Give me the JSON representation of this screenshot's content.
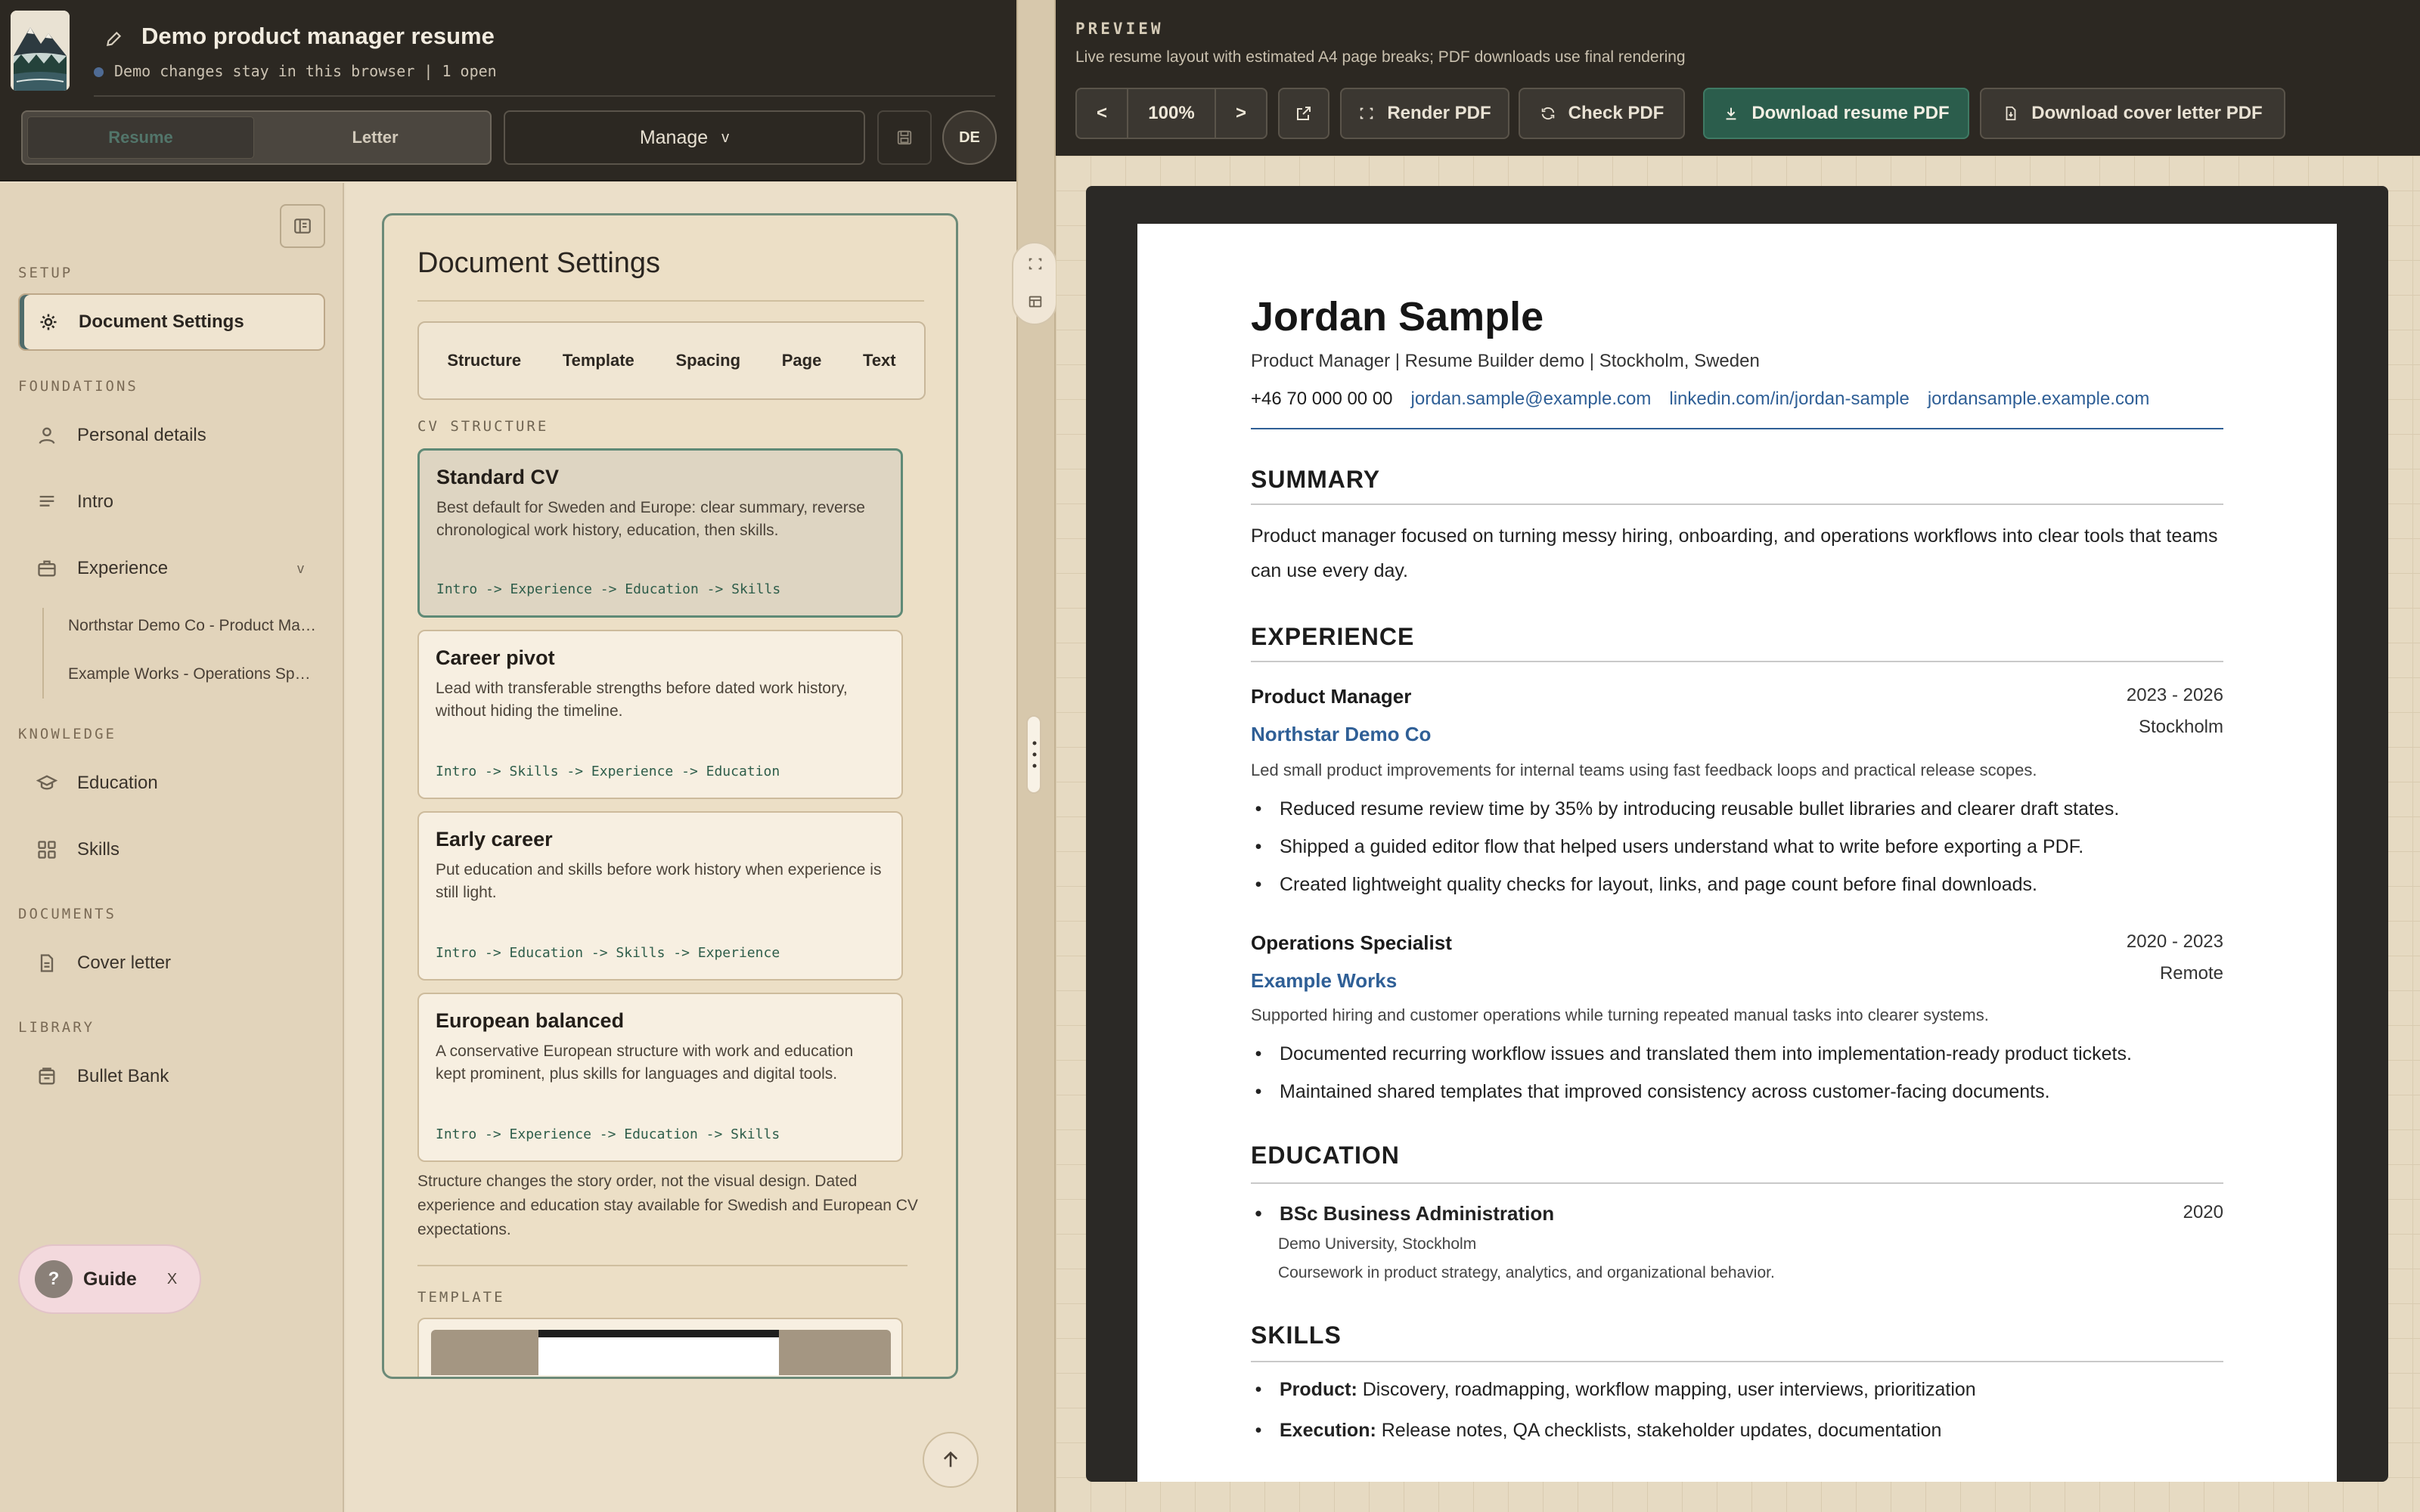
{
  "header": {
    "doc_title": "Demo product manager resume",
    "status": "Demo changes stay in this browser | 1 open",
    "mode_tabs": [
      "Resume",
      "Letter"
    ],
    "active_mode": "Resume",
    "manage_label": "Manage",
    "manage_caret": "v",
    "avatar_initials": "DE"
  },
  "sidebar": {
    "sections": {
      "setup": "SETUP",
      "foundations": "FOUNDATIONS",
      "knowledge": "KNOWLEDGE",
      "documents": "DOCUMENTS",
      "library": "LIBRARY"
    },
    "items": {
      "document_settings": "Document Settings",
      "personal_details": "Personal details",
      "intro": "Intro",
      "experience": "Experience",
      "experience_caret": "v",
      "education": "Education",
      "skills": "Skills",
      "cover_letter": "Cover letter",
      "bullet_bank": "Bullet Bank"
    },
    "experience_sub": [
      "Northstar Demo Co - Product Manager",
      "Example Works - Operations Specialist"
    ],
    "guide": {
      "q": "?",
      "label": "Guide",
      "close": "X"
    }
  },
  "settings_panel": {
    "title": "Document Settings",
    "tabs": [
      "Structure",
      "Template",
      "Spacing",
      "Page",
      "Text"
    ],
    "cv_structure_label": "CV STRUCTURE",
    "cards": [
      {
        "title": "Standard CV",
        "desc": "Best default for Sweden and Europe: clear summary, reverse chronological work history, education, then skills.",
        "flow": "Intro -> Experience -> Education -> Skills",
        "selected": true
      },
      {
        "title": "Career pivot",
        "desc": "Lead with transferable strengths before dated work history, without hiding the timeline.",
        "flow": "Intro -> Skills -> Experience -> Education",
        "selected": false
      },
      {
        "title": "Early career",
        "desc": "Put education and skills before work history when experience is still light.",
        "flow": "Intro -> Education -> Skills -> Experience",
        "selected": false
      },
      {
        "title": "European balanced",
        "desc": "A conservative European structure with work and education kept prominent, plus skills for languages and digital tools.",
        "flow": "Intro -> Experience -> Education -> Skills",
        "selected": false
      }
    ],
    "structure_note": "Structure changes the story order, not the visual design. Dated experience and education stay available for Swedish and European CV expectations.",
    "template_label": "TEMPLATE"
  },
  "preview": {
    "label": "PREVIEW",
    "subtitle": "Live resume layout with estimated A4 page breaks; PDF downloads use final rendering",
    "zoom_prev": "<",
    "zoom": "100%",
    "zoom_next": ">",
    "render_pdf": "Render PDF",
    "check_pdf": "Check PDF",
    "download_resume": "Download resume PDF",
    "download_cover": "Download cover letter PDF"
  },
  "resume": {
    "name": "Jordan Sample",
    "subtitle": "Product Manager | Resume Builder demo | Stockholm, Sweden",
    "phone": "+46 70 000 00 00",
    "email": "jordan.sample@example.com",
    "linkedin": "linkedin.com/in/jordan-sample",
    "website": "jordansample.example.com",
    "summary_heading": "SUMMARY",
    "summary": "Product manager focused on turning messy hiring, onboarding, and operations workflows into clear tools that teams can use every day.",
    "experience_heading": "EXPERIENCE",
    "jobs": [
      {
        "title": "Product Manager",
        "dates": "2023 - 2026",
        "company": "Northstar Demo Co",
        "location": "Stockholm",
        "desc": "Led small product improvements for internal teams using fast feedback loops and practical release scopes.",
        "bullets": [
          "Reduced resume review time by 35% by introducing reusable bullet libraries and clearer draft states.",
          "Shipped a guided editor flow that helped users understand what to write before exporting a PDF.",
          "Created lightweight quality checks for layout, links, and page count before final downloads."
        ]
      },
      {
        "title": "Operations Specialist",
        "dates": "2020 - 2023",
        "company": "Example Works",
        "location": "Remote",
        "desc": "Supported hiring and customer operations while turning repeated manual tasks into clearer systems.",
        "bullets": [
          "Documented recurring workflow issues and translated them into implementation-ready product tickets.",
          "Maintained shared templates that improved consistency across customer-facing documents."
        ]
      }
    ],
    "education_heading": "EDUCATION",
    "education": {
      "degree": "BSc Business Administration",
      "year": "2020",
      "school": "Demo University, Stockholm",
      "coursework": "Coursework in product strategy, analytics, and organizational behavior."
    },
    "skills_heading": "SKILLS",
    "skills": [
      {
        "label": "Product:",
        "value": "Discovery, roadmapping, workflow mapping, user interviews, prioritization"
      },
      {
        "label": "Execution:",
        "value": "Release notes, QA checklists, stakeholder updates, documentation"
      }
    ]
  },
  "colors": {
    "accent_green": "#2b5d4c",
    "link_blue": "#2f5f96",
    "dark_bar": "#2c2822",
    "sidebar_bg": "#e2d4bb"
  }
}
